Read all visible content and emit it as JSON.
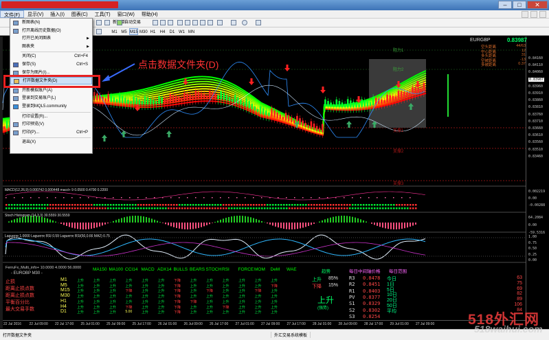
{
  "menu": {
    "items": [
      "文件(F)",
      "显示(V)",
      "插入(I)",
      "图表(C)",
      "工具(T)",
      "窗口(W)",
      "帮助(H)"
    ]
  },
  "toolbar": {
    "new_order": "新订单",
    "auto_trade": "自动交易",
    "timeframes": [
      "M1",
      "M5",
      "M15",
      "M30",
      "H1",
      "H4",
      "D1",
      "W1",
      "MN"
    ],
    "active_tf": "M15"
  },
  "file_menu": [
    {
      "label": "新图表(N)",
      "shortcut": "",
      "icon": "new-chart-icon"
    },
    {
      "label": "打开离线历史数据(O)",
      "shortcut": "",
      "icon": "open-offline-icon"
    },
    {
      "label": "打开已关闭图表",
      "shortcut": "",
      "icon": "",
      "sub": true
    },
    {
      "label": "图表夹",
      "shortcut": "",
      "icon": "",
      "sub": true
    },
    {
      "label": "关闭(C)",
      "shortcut": "Ctrl+F4",
      "icon": ""
    },
    {
      "label": "保存(S)",
      "shortcut": "Ctrl+S",
      "icon": "save-icon"
    },
    {
      "label": "保存为图片(I)...",
      "shortcut": "",
      "icon": "save-picture-icon"
    },
    {
      "label": "打开数据文件夹(D)",
      "shortcut": "",
      "icon": "folder-icon",
      "highlight": true
    },
    {
      "label": "开新模拟账户(A)",
      "shortcut": "",
      "icon": "demo-account-icon"
    },
    {
      "label": "登录到交易账户(L)",
      "shortcut": "",
      "icon": "login-icon"
    },
    {
      "label": "登录到MQL5.community",
      "shortcut": "",
      "icon": "mql5-icon"
    },
    {
      "label": "打印设置(R)...",
      "shortcut": "",
      "icon": ""
    },
    {
      "label": "打印预览(V)",
      "shortcut": "",
      "icon": "print-preview-icon"
    },
    {
      "label": "打印(P)...",
      "shortcut": "Ctrl+P",
      "icon": "print-icon"
    },
    {
      "label": "退出(X)",
      "shortcut": "",
      "icon": ""
    }
  ],
  "annotation": "点击数据文件夹(D)",
  "info_panel": {
    "symbol": "EURGBP",
    "price": "0.83987",
    "rows": [
      {
        "label": "空头距离",
        "value": "44/63"
      },
      {
        "label": "中心距离",
        "value": "12"
      },
      {
        "label": "多头距离",
        "value": "31"
      },
      {
        "label": "空被距离",
        "value": "-13"
      },
      {
        "label": "多被距离",
        "value": "0.37"
      }
    ]
  },
  "price_axis": [
    "0.84160",
    "0.84110",
    "0.84060",
    "0.83987",
    "0.83960",
    "0.83910",
    "0.83860",
    "0.83810",
    "0.83760",
    "0.83710",
    "0.83660",
    "0.83610",
    "0.83560",
    "0.83510",
    "0.83460"
  ],
  "level_labels": [
    "阻力1",
    "阻力2",
    "支撑1",
    "支撑2",
    "支撑3"
  ],
  "panes": {
    "macd": "MACD(12,26,9) 0.000742 0.000448  macd+ 9 0.0500 0.4700 0.2200",
    "macd_axis": [
      "0.002219",
      "0.00",
      "-0.00288"
    ],
    "stoch": "Stoch Histogram (14,3,3) 30.5559 30.5559",
    "stoch_axis": [
      "64.2084",
      "0.00",
      "-59.5316"
    ],
    "laguerre": "Laguerre 1.0000  Laguerre RSI 0.59  Laguerre RSI(50,0.66 MA2) 0.75",
    "laguerre_axis": [
      "1.00",
      "0.75",
      "0.50",
      "0.25",
      "0.00"
    ]
  },
  "bottom": {
    "title": "FerruFx_Multi_info+ 10.0000 4.0000 56.0000",
    "subtitle": "- EUROBP M30 -",
    "left_labels": [
      "止损",
      "距离止损点数",
      "距离止损点数",
      "平衡百分比",
      "最大交易手数"
    ],
    "indicator_headers": [
      "MA150",
      "MA100",
      "CCI14",
      "MACD",
      "ADX14",
      "BULLS",
      "BEARS",
      "STOCH",
      "RSI",
      "FORCE",
      "MOM",
      "DeM",
      "WAE"
    ],
    "timeframes": [
      "M1",
      "M5",
      "M15",
      "M30",
      "H1",
      "H4",
      "D1"
    ],
    "cell_up": "上升",
    "cell_down": "下降",
    "lot_value": "5.00",
    "trend_header": "趋势",
    "pivot_header": "每日中间轴价格",
    "daily_header": "每日范围",
    "up_label": "上升",
    "up_pct": "85%",
    "down_label": "下降",
    "down_pct": "15%",
    "big_signal": "上升",
    "big_signal_sub": "(强势)",
    "pivots": [
      {
        "k": "R3",
        "v": "0.8478"
      },
      {
        "k": "R2",
        "v": "0.8451"
      },
      {
        "k": "R1",
        "v": "0.8403"
      },
      {
        "k": "PV",
        "v": "0.8377"
      },
      {
        "k": "S1",
        "v": "0.8329"
      },
      {
        "k": "S2",
        "v": "0.8302"
      },
      {
        "k": "S3",
        "v": "0.8254"
      }
    ],
    "days": [
      {
        "k": "今日",
        "v": "63"
      },
      {
        "k": "1日",
        "v": "75"
      },
      {
        "k": "5日",
        "v": "69"
      },
      {
        "k": "10日",
        "v": "82"
      },
      {
        "k": "20日",
        "v": "89"
      },
      {
        "k": "50日",
        "v": "106"
      },
      {
        "k": "平均",
        "v": "84"
      }
    ]
  },
  "time_axis": [
    "22 Jul 2016",
    "22 Jul 09:00",
    "22 Jul 17:00",
    "25 Jul 01:00",
    "25 Jul 09:00",
    "25 Jul 17:00",
    "26 Jul 01:00",
    "26 Jul 09:00",
    "26 Jul 17:00",
    "27 Jul 01:00",
    "27 Jul 09:00",
    "27 Jul 17:00",
    "28 Jul 01:00",
    "28 Jul 09:00",
    "28 Jul 17:00",
    "29 Jul 01:00",
    "27 Jul 09:00"
  ],
  "status": {
    "left": "打开数据文件夹",
    "middle": "外汇交易系统模板"
  },
  "watermark": {
    "cn": "518外汇网",
    "url": "518waihui.com"
  }
}
